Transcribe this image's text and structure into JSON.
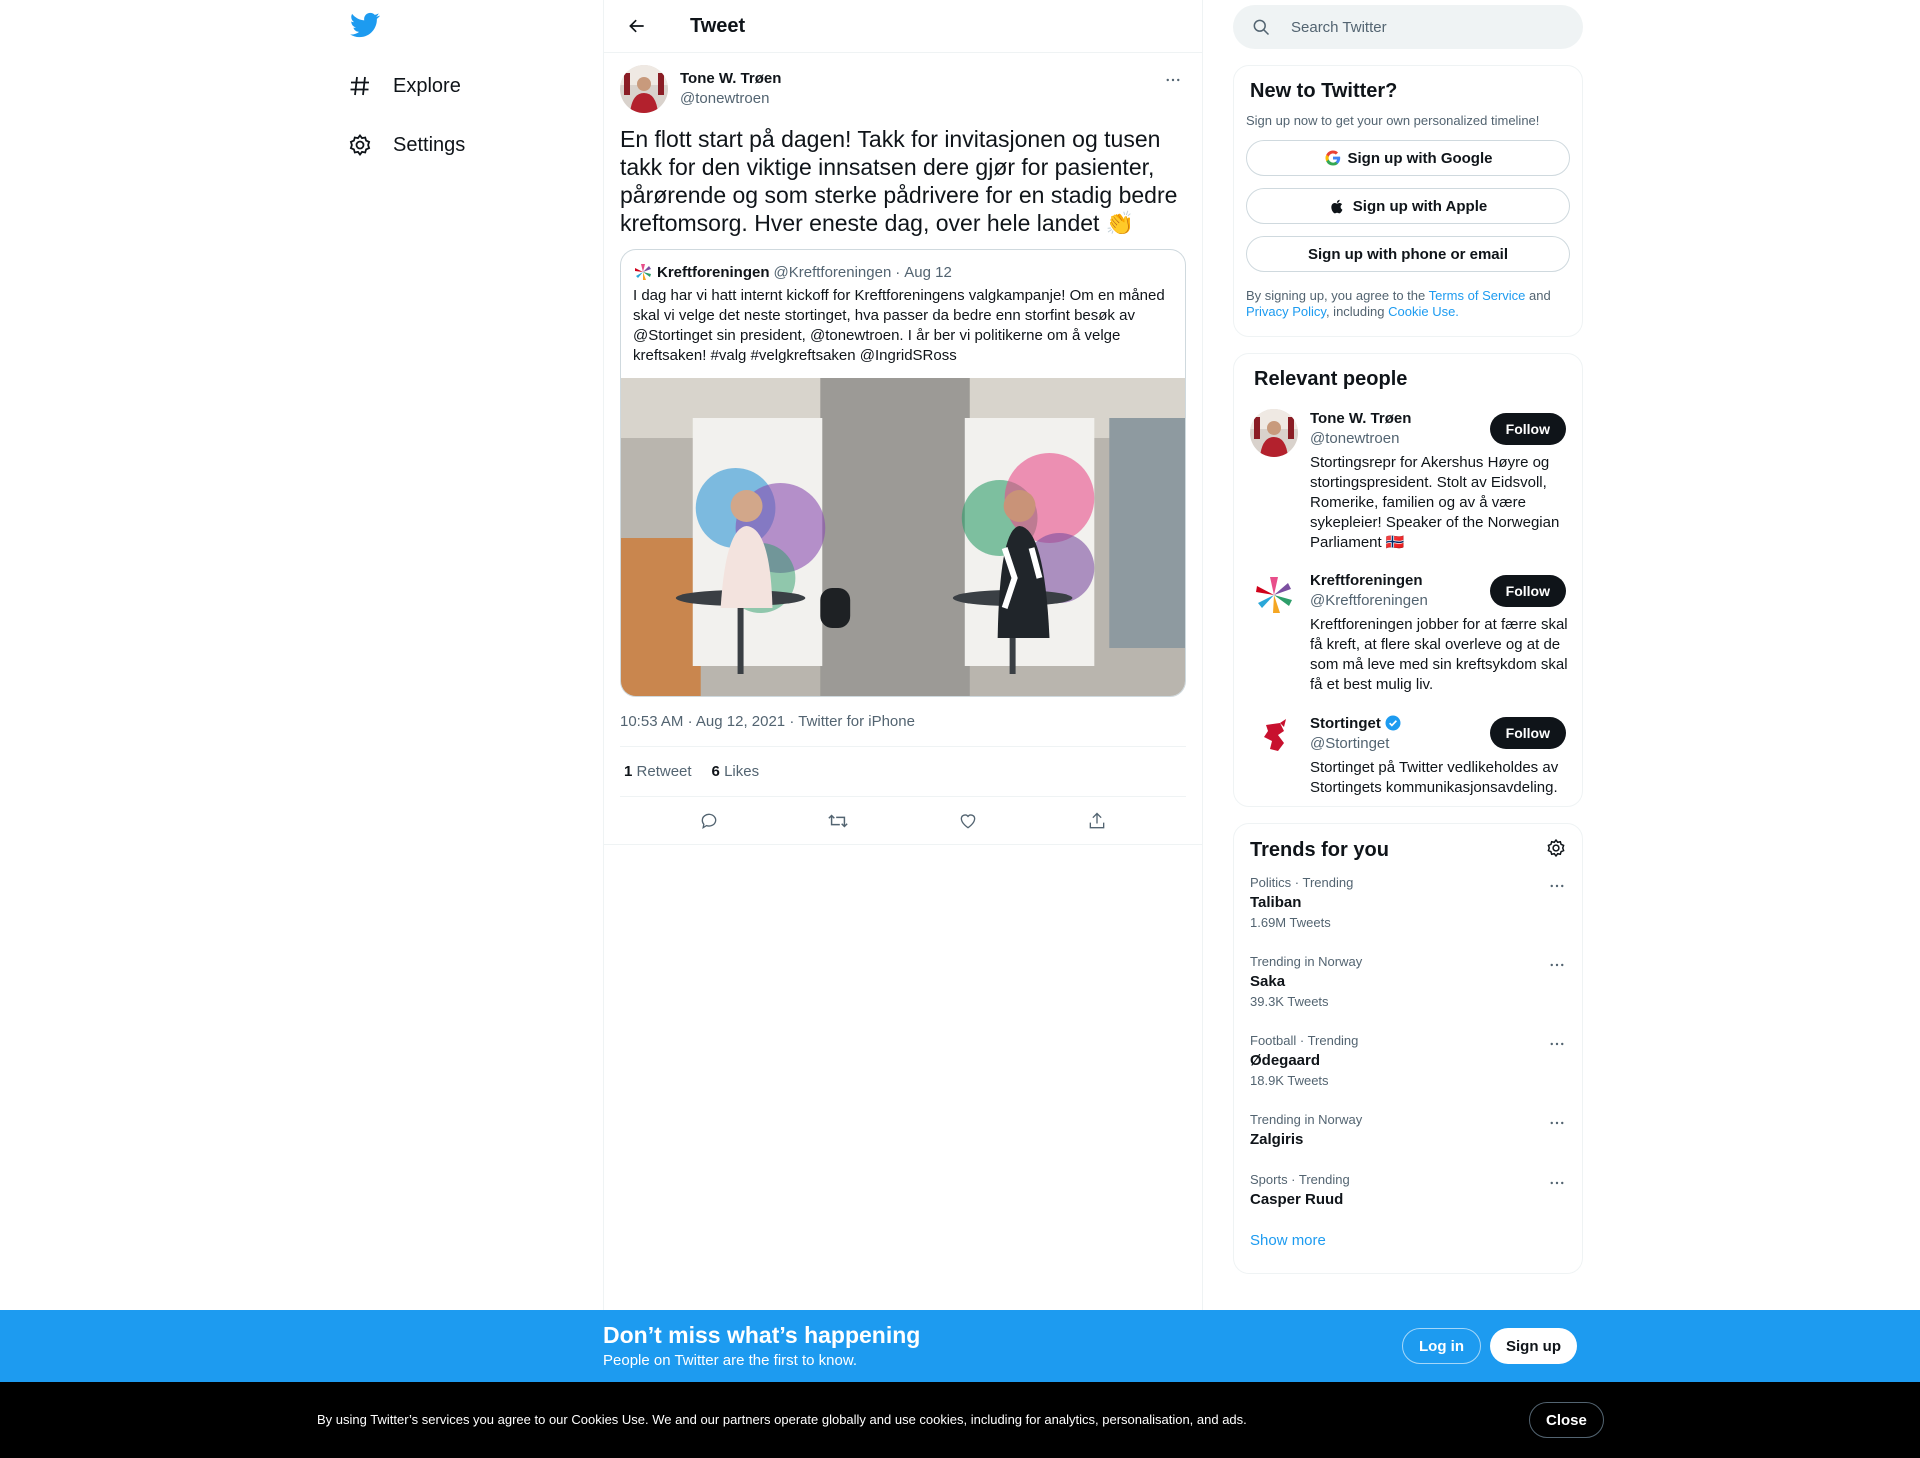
{
  "colors": {
    "accent": "#1d9bf0",
    "text": "#0f1419",
    "secondary": "#536471",
    "cookie_bg": "#000000"
  },
  "nav": {
    "logo_icon": "twitter-bird-icon",
    "items": [
      {
        "label": "Explore",
        "icon": "hashtag-icon"
      },
      {
        "label": "Settings",
        "icon": "gear-icon"
      }
    ]
  },
  "header": {
    "title": "Tweet",
    "back_icon": "arrow-left-icon"
  },
  "tweet": {
    "author_name": "Tone W. Trøen",
    "author_handle": "@tonewtroen",
    "text": "En flott start på dagen! Takk for invitasjonen og tusen takk for den viktige innsatsen dere gjør for pasienter, pårørende og som sterke pådrivere for en stadig bedre kreftomsorg. Hver eneste dag, over hele landet 👏",
    "quote": {
      "name": "Kreftforeningen",
      "handle": "@Kreftforeningen",
      "sep": "·",
      "date": "Aug 12",
      "text": "I dag har vi hatt internt kickoff for Kreftforeningens valgkampanje! Om en måned skal vi velge det neste stortinget, hva passer da bedre enn storfint besøk av @Stortinget sin president, @tonewtroen. I år ber vi politikerne om å velge kreftsaken! #valg #velgkreftsaken @IngridSRoss"
    },
    "time": "10:53 AM",
    "meta_sep": "·",
    "date": "Aug 12, 2021",
    "source": "Twitter for iPhone",
    "retweets": {
      "count": "1",
      "label": "Retweet"
    },
    "likes": {
      "count": "6",
      "label": "Likes"
    }
  },
  "search": {
    "placeholder": "Search Twitter"
  },
  "new_to_twitter": {
    "title": "New to Twitter?",
    "subtitle": "Sign up now to get your own personalized timeline!",
    "google": "Sign up with Google",
    "apple": "Sign up with Apple",
    "phone": "Sign up with phone or email",
    "legal_pre": "By signing up, you agree to the ",
    "terms": "Terms of Service",
    "legal_and": " and ",
    "privacy": "Privacy Policy",
    "legal_inc": ", including ",
    "cookie": "Cookie Use."
  },
  "relevant": {
    "title": "Relevant people",
    "follow_label": "Follow",
    "people": [
      {
        "name": "Tone W. Trøen",
        "handle": "@tonewtroen",
        "bio": "Stortingsrepr for Akershus Høyre og stortingspresident. Stolt av Eidsvoll, Romerike, familien og av å være sykepleier! Speaker of the Norwegian Parliament 🇳🇴"
      },
      {
        "name": "Kreftforeningen",
        "handle": "@Kreftforeningen",
        "bio": "Kreftforeningen jobber for at færre skal få kreft, at flere skal overleve og at de som må leve med sin kreftsykdom skal få et best mulig liv."
      },
      {
        "name": "Stortinget",
        "handle": "@Stortinget",
        "verified": true,
        "bio": "Stortinget på Twitter vedlikeholdes av Stortingets kommunikasjonsavdeling."
      }
    ]
  },
  "trends": {
    "title": "Trends for you",
    "items": [
      {
        "category": "Politics · Trending",
        "name": "Taliban",
        "count": "1.69M Tweets"
      },
      {
        "category": "Trending in Norway",
        "name": "Saka",
        "count": "39.3K Tweets"
      },
      {
        "category": "Football · Trending",
        "name": "Ødegaard",
        "count": "18.9K Tweets"
      },
      {
        "category": "Trending in Norway",
        "name": "Zalgiris",
        "count": ""
      },
      {
        "category": "Sports · Trending",
        "name": "Casper Ruud",
        "count": ""
      }
    ],
    "show_more": "Show more"
  },
  "banner": {
    "title": "Don’t miss what’s happening",
    "subtitle": "People on Twitter are the first to know.",
    "login": "Log in",
    "signup": "Sign up"
  },
  "cookies": {
    "text": "By using Twitter’s services you agree to our Cookies Use. We and our partners operate globally and use cookies, including for analytics, personalisation, and ads.",
    "close": "Close"
  }
}
